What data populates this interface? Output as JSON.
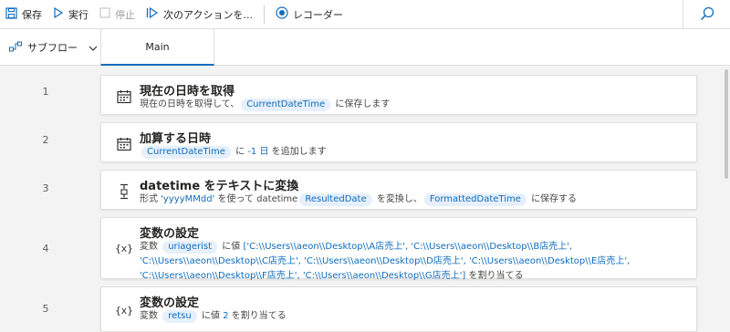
{
  "toolbar": {
    "save": "保存",
    "run": "実行",
    "stop": "停止",
    "next_action": "次のアクションを...",
    "recorder": "レコーダー"
  },
  "tabs": {
    "subflow": "サブフロー",
    "main": "Main"
  },
  "colors": {
    "accent": "#0f6cbd",
    "variable_bg": "#e6f0fb",
    "canvas_bg": "#f3f3f3"
  },
  "actions": [
    {
      "line": "1",
      "icon": "calendar-icon",
      "title": "現在の日時を取得",
      "desc": {
        "p1": "現在の日時を取得して、",
        "v1": "CurrentDateTime",
        "p2": "に保存します"
      }
    },
    {
      "line": "2",
      "icon": "calendar-icon",
      "title": "加算する日時",
      "desc": {
        "v1": "CurrentDateTime",
        "p1": "に",
        "lit1": "-1 日",
        "p2": "を追加します"
      }
    },
    {
      "line": "3",
      "icon": "convert-icon",
      "title": "datetime をテキストに変換",
      "desc": {
        "p1": "形式",
        "lit1": "'yyyyMMdd'",
        "p2": "を使って datetime",
        "v1": "ResultedDate",
        "p3": "を変換し、",
        "v2": "FormattedDateTime",
        "p4": "に保存する"
      }
    },
    {
      "line": "4",
      "icon": "variable-icon",
      "title": "変数の設定",
      "desc": {
        "p1": "変数",
        "v1": "uriagerist",
        "p2": "に値",
        "lit1": "['C:\\\\Users\\\\aeon\\\\Desktop\\\\A店売上', 'C:\\\\Users\\\\aeon\\\\Desktop\\\\B店売上', 'C:\\\\Users\\\\aeon\\\\Desktop\\\\C店売上', 'C:\\\\Users\\\\aeon\\\\Desktop\\\\D店売上', 'C:\\\\Users\\\\aeon\\\\Desktop\\\\E店売上', 'C:\\\\Users\\\\aeon\\\\Desktop\\\\F店売上', 'C:\\\\Users\\\\aeon\\\\Desktop\\\\G店売上']",
        "p3": "を割り当てる"
      }
    },
    {
      "line": "5",
      "icon": "variable-icon",
      "title": "変数の設定",
      "desc": {
        "p1": "変数",
        "v1": "retsu",
        "p2": "に値",
        "lit1": "2",
        "p3": "を割り当てる"
      }
    }
  ]
}
